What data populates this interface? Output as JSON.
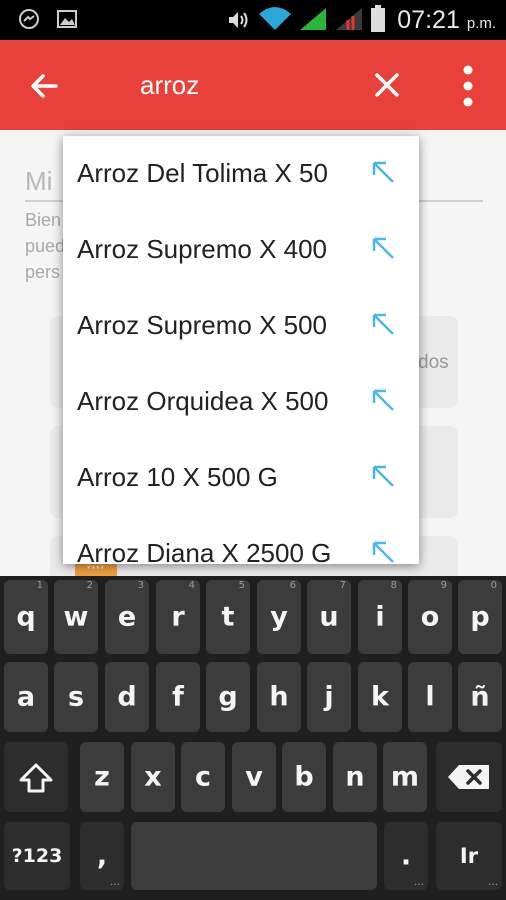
{
  "status_bar": {
    "time": "07:21",
    "ampm": "p.m.",
    "icons": [
      "messenger-icon",
      "image-icon",
      "volume-icon",
      "wifi-icon",
      "signal-icon",
      "signal-off-icon",
      "battery-icon"
    ]
  },
  "app_bar": {
    "query": "arroz",
    "back_icon": "arrow-left-icon",
    "clear_icon": "close-icon",
    "menu_icon": "overflow-menu-icon",
    "color": "#e8403a"
  },
  "background": {
    "field_text": "Mi",
    "desc_lines": [
      "Bien",
      "pued",
      "pers"
    ],
    "card_text": "dos",
    "badge": "****"
  },
  "suggestions": [
    {
      "label": "Arroz Del Tolima X 50"
    },
    {
      "label": "Arroz Supremo X 400"
    },
    {
      "label": "Arroz Supremo X 500"
    },
    {
      "label": "Arroz Orquidea X 500"
    },
    {
      "label": "Arroz 10 X 500 G"
    },
    {
      "label": "Arroz Diana X 2500 G"
    }
  ],
  "keyboard": {
    "row1": [
      {
        "k": "q",
        "h": "1"
      },
      {
        "k": "w",
        "h": "2"
      },
      {
        "k": "e",
        "h": "3"
      },
      {
        "k": "r",
        "h": "4"
      },
      {
        "k": "t",
        "h": "5"
      },
      {
        "k": "y",
        "h": "6"
      },
      {
        "k": "u",
        "h": "7"
      },
      {
        "k": "i",
        "h": "8"
      },
      {
        "k": "o",
        "h": "9"
      },
      {
        "k": "p",
        "h": "0"
      }
    ],
    "row2": [
      "a",
      "s",
      "d",
      "f",
      "g",
      "h",
      "j",
      "k",
      "l",
      "ñ"
    ],
    "row3": [
      "z",
      "x",
      "c",
      "v",
      "b",
      "n",
      "m"
    ],
    "symbols_key": "?123",
    "comma_key": ",",
    "period_key": ".",
    "go_key": "Ir",
    "shift_icon": "shift-icon",
    "backspace_icon": "backspace-icon"
  }
}
